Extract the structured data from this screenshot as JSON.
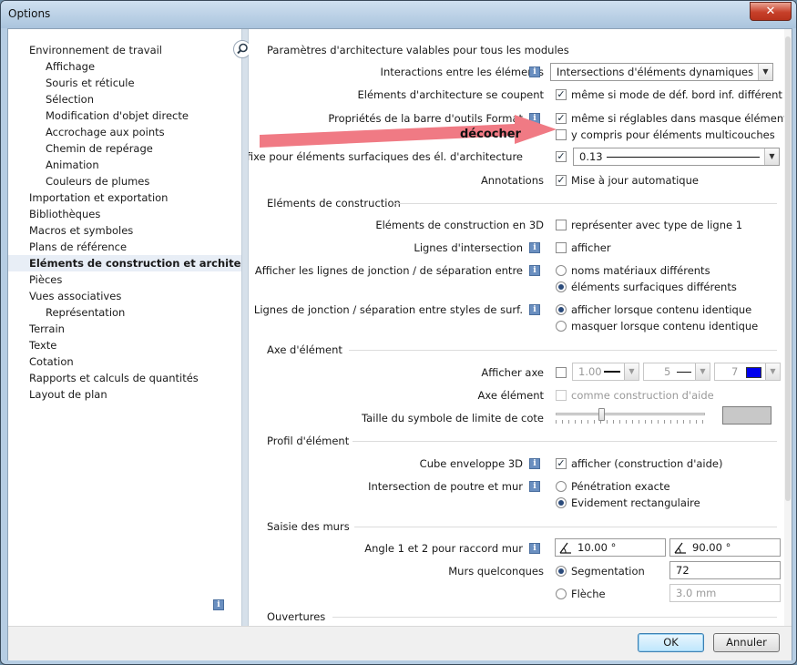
{
  "window": {
    "title": "Options",
    "close_label": "✕"
  },
  "tree": {
    "items": [
      {
        "label": "Environnement de travail"
      },
      {
        "label": "Affichage"
      },
      {
        "label": "Souris et réticule"
      },
      {
        "label": "Sélection"
      },
      {
        "label": "Modification d'objet directe"
      },
      {
        "label": "Accrochage aux points"
      },
      {
        "label": "Chemin de repérage"
      },
      {
        "label": "Animation"
      },
      {
        "label": "Couleurs de plumes"
      },
      {
        "label": "Importation et exportation"
      },
      {
        "label": "Bibliothèques"
      },
      {
        "label": "Macros et symboles"
      },
      {
        "label": "Plans de référence"
      },
      {
        "label": "Eléments de construction et architecture"
      },
      {
        "label": "Pièces"
      },
      {
        "label": "Vues associatives"
      },
      {
        "label": "Représentation"
      },
      {
        "label": "Terrain"
      },
      {
        "label": "Texte"
      },
      {
        "label": "Cotation"
      },
      {
        "label": "Rapports et calculs de quantités"
      },
      {
        "label": "Layout de plan"
      }
    ]
  },
  "info_glyph": "i",
  "sections": {
    "architecture": "Paramètres d'architecture valables pour tous les modules",
    "construction": "Eléments de construction",
    "axe": "Axe d'élément",
    "profil": "Profil d'élément",
    "murs": "Saisie des murs",
    "ouvertures": "Ouvertures"
  },
  "architecture": {
    "interactions_label": "Interactions entre les éléments",
    "interactions_value": "Intersections d'éléments dynamiques",
    "coupent_label": "Eléments d'architecture se coupent",
    "coupent_option": "même si mode de déf. bord inf. différent",
    "barre_label": "Propriétés de la barre d'outils Format",
    "barre_option1": "même si réglables dans masque élément",
    "barre_option2": "y compris pour éléments multicouches",
    "plume_label": "Plume fixe pour éléments surfaciques des él. d'architecture",
    "plume_value": "0.13",
    "annotations_label": "Annotations",
    "annotations_option": "Mise à jour automatique"
  },
  "annotation": {
    "text": "décocher",
    "arrow_color": "#f07a84"
  },
  "construction": {
    "e3d_label": "Eléments de construction en 3D",
    "e3d_option": "représenter avec type de ligne 1",
    "lignes_label": "Lignes d'intersection",
    "lignes_option": "afficher",
    "jonction_label": "Afficher les lignes de jonction / de séparation entre",
    "jonction_opt1": "noms matériaux différents",
    "jonction_opt2": "éléments surfaciques différents",
    "styles_label": "Lignes de jonction / séparation entre styles de surf.",
    "styles_opt1": "afficher lorsque contenu identique",
    "styles_opt2": "masquer lorsque contenu identique"
  },
  "axe": {
    "afficher_label": "Afficher axe",
    "pen_value": "1.00",
    "line_value": "5",
    "color_value": "7",
    "color_swatch": "#0000ee",
    "element_label": "Axe élément",
    "element_option": "comme construction d'aide",
    "taille_label": "Taille du symbole de limite de cote",
    "slider_level": 0.3,
    "preview_color": "#c8c8c8"
  },
  "profil": {
    "cube_label": "Cube enveloppe 3D",
    "cube_option": "afficher (construction d'aide)",
    "poutre_label": "Intersection de poutre et mur",
    "poutre_opt1": "Pénétration exacte",
    "poutre_opt2": "Evidement rectangulaire"
  },
  "murs": {
    "angle_label": "Angle 1 et 2 pour raccord mur",
    "angle1": "10.00 °",
    "angle2": "90.00 °",
    "quelconques_label": "Murs quelconques",
    "segmentation_label": "Segmentation",
    "segmentation_value": "72",
    "fleche_label": "Flèche",
    "fleche_value": "3.0 mm"
  },
  "buttons": {
    "ok": "OK",
    "cancel": "Annuler"
  }
}
